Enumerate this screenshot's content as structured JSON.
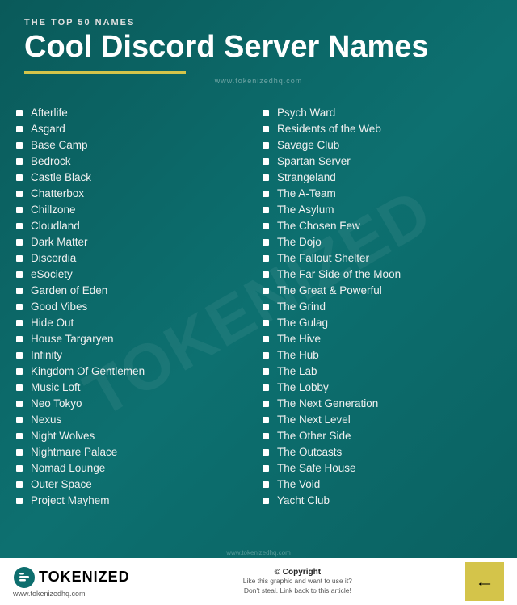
{
  "header": {
    "subtitle": "THE TOP 50 NAMES",
    "title": "Cool Discord Server Names",
    "url": "www.tokenizedhq.com"
  },
  "columns": {
    "left": [
      "Afterlife",
      "Asgard",
      "Base Camp",
      "Bedrock",
      "Castle Black",
      "Chatterbox",
      "Chillzone",
      "Cloudland",
      "Dark Matter",
      "Discordia",
      "eSociety",
      "Garden of Eden",
      "Good Vibes",
      "Hide Out",
      "House Targaryen",
      "Infinity",
      "Kingdom Of Gentlemen",
      "Music Loft",
      "Neo Tokyo",
      "Nexus",
      "Night Wolves",
      "Nightmare Palace",
      "Nomad Lounge",
      "Outer Space",
      "Project Mayhem"
    ],
    "right": [
      "Psych Ward",
      "Residents of the Web",
      "Savage Club",
      "Spartan Server",
      "Strangeland",
      "The A-Team",
      "The Asylum",
      "The Chosen Few",
      "The Dojo",
      "The Fallout Shelter",
      "The Far Side of the Moon",
      "The Great & Powerful",
      "The Grind",
      "The Gulag",
      "The Hive",
      "The Hub",
      "The Lab",
      "The Lobby",
      "The Next Generation",
      "The Next Level",
      "The Other Side",
      "The Outcasts",
      "The Safe House",
      "The Void",
      "Yacht Club"
    ]
  },
  "footer": {
    "logo_text": "TOKENIZED",
    "url": "www.tokenizedhq.com",
    "copyright_title": "© Copyright",
    "copyright_desc": "Like this graphic and want to use it?\nDon't steal. Link back to this article!",
    "watermark": "TOKENIZED"
  }
}
